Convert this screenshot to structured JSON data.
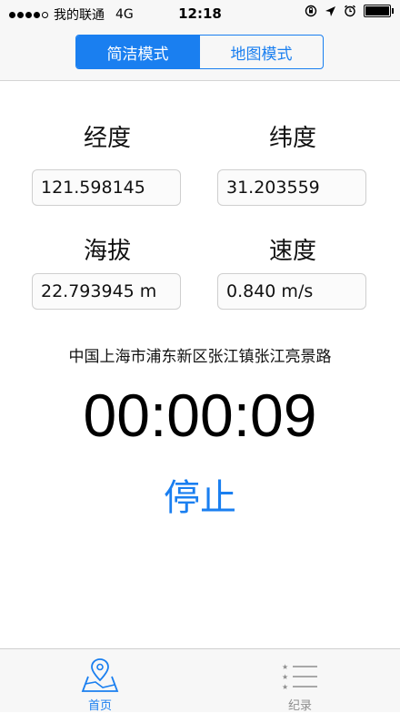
{
  "status": {
    "carrier": "我的联通",
    "network": "4G",
    "time": "12:18"
  },
  "segmented": {
    "simple_mode": "简洁模式",
    "map_mode": "地图模式"
  },
  "metrics": {
    "longitude_label": "经度",
    "longitude_value": "121.598145",
    "latitude_label": "纬度",
    "latitude_value": "31.203559",
    "altitude_label": "海拔",
    "altitude_value": "22.793945 m",
    "speed_label": "速度",
    "speed_value": "0.840 m/s"
  },
  "address": "中国上海市浦东新区张江镇张江亮景路",
  "timer": "00:00:09",
  "stop_label": "停止",
  "tabbar": {
    "home_label": "首页",
    "records_label": "纪录"
  },
  "colors": {
    "accent": "#1a7ff0",
    "inactive": "#8e8e8e"
  }
}
